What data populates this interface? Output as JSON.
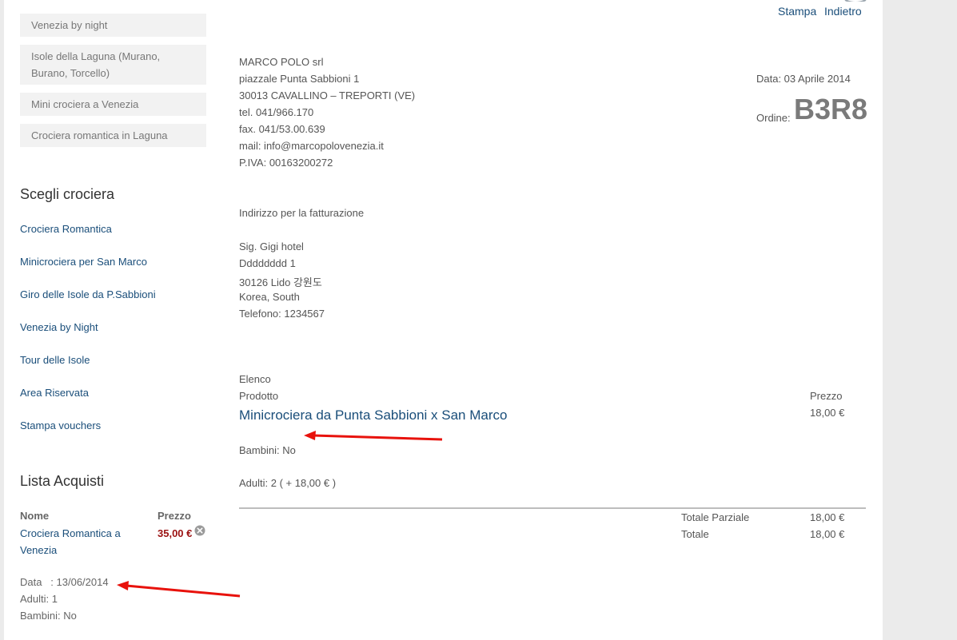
{
  "sidebar": {
    "tours": [
      "Venezia by night",
      "Isole della Laguna (Murano, Burano, Torcello)",
      "Mini crociera a Venezia",
      "Crociera romantica in Laguna"
    ],
    "choose_heading": "Scegli crociera",
    "cruises": [
      "Crociera Romantica",
      "Minicrociera per San Marco",
      "Giro delle Isole da P.Sabbioni",
      "Venezia by Night",
      "Tour delle Isole",
      "Area Riservata",
      "Stampa vouchers"
    ],
    "cart": {
      "heading": "Lista Acquisti",
      "col_name": "Nome",
      "col_price": "Prezzo",
      "item_name": "Crociera Romantica a Venezia",
      "item_price": "35,00 €",
      "date": "Data   : 13/06/2014",
      "adults": "Adulti: 1",
      "children": "Bambini: No"
    }
  },
  "header": {
    "print_label": "Stampa",
    "back_label": "Indietro"
  },
  "company": {
    "name": "MARCO POLO srl",
    "street": "piazzale Punta Sabbioni 1",
    "city": "30013 CAVALLINO – TREPORTI (VE)",
    "tel": "tel. 041/966.170",
    "fax": "fax. 041/53.00.639",
    "mail": "mail: info@marcopolovenezia.it",
    "vat": "P.IVA: 00163200272"
  },
  "order": {
    "date": "Data: 03 Aprile 2014",
    "label": "Ordine:",
    "code": "B3R8"
  },
  "billing": {
    "heading": "Indirizzo per la fatturazione",
    "name": "Sig. Gigi hotel",
    "street": "Dddddddd 1",
    "city": "30126 Lido 강원도",
    "country": "Korea, South",
    "phone": "Telefono: 1234567"
  },
  "items": {
    "list_label": "Elenco",
    "col_product": "Prodotto",
    "col_price": "Prezzo",
    "product_name": "Minicrociera da Punta Sabbioni x San Marco",
    "product_price": "18,00 €",
    "children": "Bambini: No",
    "adults": "Adulti: 2 ( + 18,00 € )"
  },
  "totals": {
    "subtotal_label": "Totale Parziale",
    "subtotal_value": "18,00 €",
    "total_label": "Totale",
    "total_value": "18,00 €"
  },
  "colors": {
    "link": "#1a4e7a",
    "price": "#9b1111",
    "annotation_arrow": "#e8120c"
  }
}
